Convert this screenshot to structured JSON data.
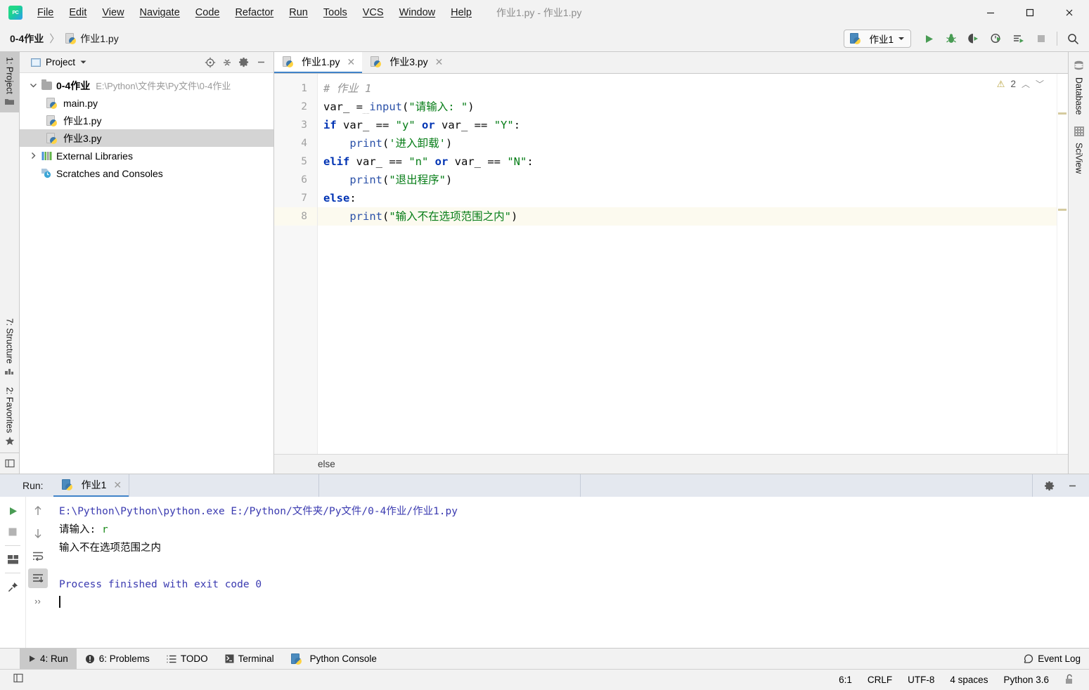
{
  "window": {
    "title": "作业1.py - 作业1.py",
    "logo": "pycharm-logo",
    "controls": {
      "minimize": "minimize-icon",
      "maximize": "maximize-icon",
      "close": "close-icon"
    }
  },
  "menu": [
    {
      "label": "File",
      "mnemonic": "F"
    },
    {
      "label": "Edit",
      "mnemonic": "E"
    },
    {
      "label": "View",
      "mnemonic": "V"
    },
    {
      "label": "Navigate",
      "mnemonic": "N"
    },
    {
      "label": "Code",
      "mnemonic": "C"
    },
    {
      "label": "Refactor",
      "mnemonic": "R"
    },
    {
      "label": "Run",
      "mnemonic": "u"
    },
    {
      "label": "Tools",
      "mnemonic": "T"
    },
    {
      "label": "VCS",
      "mnemonic": "S"
    },
    {
      "label": "Window",
      "mnemonic": "W"
    },
    {
      "label": "Help",
      "mnemonic": "H"
    }
  ],
  "breadcrumb": {
    "project": "0-4作业",
    "separator": "〉",
    "file": "作业1.py"
  },
  "run_toolbar": {
    "config_name": "作业1",
    "buttons": [
      "run-icon",
      "debug-icon",
      "run-coverage-icon",
      "profile-icon",
      "run-with-console-icon",
      "stop-icon",
      "search-everywhere-icon"
    ]
  },
  "left_strip": {
    "top": [
      {
        "label": "1: Project",
        "icon": "project-icon",
        "active": true
      }
    ],
    "bottom": [
      {
        "label": "7: Structure",
        "icon": "structure-icon",
        "active": false
      },
      {
        "label": "2: Favorites",
        "icon": "favorites-star-icon",
        "active": false
      }
    ],
    "bottom_icon": "layout-icon"
  },
  "right_strip": [
    {
      "label": "Database",
      "icon": "database-icon"
    },
    {
      "label": "SciView",
      "icon": "sciview-grid-icon"
    }
  ],
  "project_panel": {
    "title": "Project",
    "dropdown": "chevron-down-icon",
    "header_buttons": [
      "locate-icon",
      "collapse-all-icon",
      "settings-gear-icon",
      "hide-icon"
    ],
    "tree": [
      {
        "label": "0-4作业",
        "path": "E:\\Python\\文件夹\\Py文件\\0-4作业",
        "icon": "folder-icon",
        "twisty": "expanded",
        "depth": 0,
        "bold": true,
        "selected": false
      },
      {
        "label": "main.py",
        "path": "",
        "icon": "python-file-icon",
        "twisty": "none",
        "depth": 1,
        "bold": false,
        "selected": false
      },
      {
        "label": "作业1.py",
        "path": "",
        "icon": "python-file-icon",
        "twisty": "none",
        "depth": 1,
        "bold": false,
        "selected": false
      },
      {
        "label": "作业3.py",
        "path": "",
        "icon": "python-file-icon",
        "twisty": "none",
        "depth": 1,
        "bold": false,
        "selected": true
      },
      {
        "label": "External Libraries",
        "path": "",
        "icon": "libraries-icon",
        "twisty": "collapsed",
        "depth": 0,
        "bold": false,
        "selected": false
      },
      {
        "label": "Scratches and Consoles",
        "path": "",
        "icon": "scratches-icon",
        "twisty": "none",
        "depth": 0,
        "bold": false,
        "selected": false
      }
    ]
  },
  "editor": {
    "tabs": [
      {
        "label": "作业1.py",
        "icon": "python-file-icon",
        "active": true,
        "close": "close-icon"
      },
      {
        "label": "作业3.py",
        "icon": "python-file-icon",
        "active": false,
        "close": "close-icon"
      }
    ],
    "inspection": {
      "warning_icon": "warning-triangle-icon",
      "warning_count": "2",
      "prev": "chevron-up-icon",
      "next": "chevron-down-icon"
    },
    "line_numbers": [
      "1",
      "2",
      "3",
      "4",
      "5",
      "6",
      "7",
      "8"
    ],
    "current_line": 8,
    "lines": [
      {
        "n": 1,
        "tokens": [
          {
            "t": "# 作业 1",
            "c": "comment"
          }
        ]
      },
      {
        "n": 2,
        "tokens": [
          {
            "t": "var_ ",
            "c": "plain"
          },
          {
            "t": "=",
            "c": "op"
          },
          {
            "t": " ",
            "c": "squiggle"
          },
          {
            "t": "input",
            "c": "builtin"
          },
          {
            "t": "(",
            "c": "plain"
          },
          {
            "t": "\"请输入: \"",
            "c": "str"
          },
          {
            "t": ")",
            "c": "plain"
          }
        ]
      },
      {
        "n": 3,
        "tokens": [
          {
            "t": "if",
            "c": "kw"
          },
          {
            "t": " var_ == ",
            "c": "plain"
          },
          {
            "t": "\"y\"",
            "c": "str"
          },
          {
            "t": " ",
            "c": "plain"
          },
          {
            "t": "or",
            "c": "kw"
          },
          {
            "t": " var_ == ",
            "c": "plain"
          },
          {
            "t": "\"Y\"",
            "c": "str"
          },
          {
            "t": ":",
            "c": "plain"
          }
        ]
      },
      {
        "n": 4,
        "tokens": [
          {
            "t": "    ",
            "c": "plain"
          },
          {
            "t": "print",
            "c": "builtin"
          },
          {
            "t": "(",
            "c": "plain"
          },
          {
            "t": "'进入卸载'",
            "c": "str"
          },
          {
            "t": ")",
            "c": "plain"
          }
        ]
      },
      {
        "n": 5,
        "tokens": [
          {
            "t": "elif",
            "c": "kw"
          },
          {
            "t": " var_ == ",
            "c": "plain"
          },
          {
            "t": "\"n\"",
            "c": "str"
          },
          {
            "t": " ",
            "c": "plain"
          },
          {
            "t": "or",
            "c": "kw"
          },
          {
            "t": " var_ == ",
            "c": "plain"
          },
          {
            "t": "\"N\"",
            "c": "str"
          },
          {
            "t": ":",
            "c": "plain"
          }
        ]
      },
      {
        "n": 6,
        "tokens": [
          {
            "t": "    ",
            "c": "plain"
          },
          {
            "t": "print",
            "c": "builtin"
          },
          {
            "t": "(",
            "c": "plain"
          },
          {
            "t": "\"退出程序\"",
            "c": "str"
          },
          {
            "t": ")",
            "c": "plain"
          }
        ]
      },
      {
        "n": 7,
        "tokens": [
          {
            "t": "else",
            "c": "kw"
          },
          {
            "t": ":",
            "c": "plain"
          }
        ]
      },
      {
        "n": 8,
        "tokens": [
          {
            "t": "    ",
            "c": "plain"
          },
          {
            "t": "print",
            "c": "builtin"
          },
          {
            "t": "(",
            "c": "plain"
          },
          {
            "t": "\"输入不在选项范围之内\"",
            "c": "str"
          },
          {
            "t": ")",
            "c": "plain"
          }
        ]
      }
    ],
    "breadcrumb_trail": "else"
  },
  "run_window": {
    "label": "Run:",
    "tab": {
      "label": "作业1",
      "icon": "python-icon",
      "close": "close-icon"
    },
    "header_buttons": [
      "settings-gear-icon",
      "hide-window-icon"
    ],
    "side_buttons": [
      "rerun-icon",
      "stop-icon",
      "layout-icon",
      "pin-icon"
    ],
    "side_buttons2": [
      "up-arrow-icon",
      "down-arrow-icon",
      "soft-wrap-icon",
      "scroll-to-end-icon",
      "more-icon"
    ],
    "console": [
      {
        "text": "E:\\Python\\Python\\python.exe E:/Python/文件夹/Py文件/0-4作业/作业1.py",
        "style": "cmd"
      },
      {
        "text": "请输入: ",
        "style": "plain",
        "suffix": "r",
        "suffix_style": "green"
      },
      {
        "text": "输入不在选项范围之内",
        "style": "plain"
      },
      {
        "text": "",
        "style": "plain"
      },
      {
        "text": "Process finished with exit code 0",
        "style": "cmd"
      }
    ]
  },
  "bottom_bar": {
    "items": [
      {
        "label": "4: Run",
        "mnemonic": "4",
        "icon": "run-triangle-icon",
        "active": true
      },
      {
        "label": "6: Problems",
        "mnemonic": "6",
        "icon": "problems-icon",
        "active": false
      },
      {
        "label": "TODO",
        "mnemonic": "",
        "icon": "todo-list-icon",
        "active": false
      },
      {
        "label": "Terminal",
        "mnemonic": "",
        "icon": "terminal-icon",
        "active": false
      },
      {
        "label": "Python Console",
        "mnemonic": "",
        "icon": "python-icon",
        "active": false
      }
    ],
    "event_log": {
      "label": "Event Log",
      "icon": "event-log-icon"
    }
  },
  "status_bar": {
    "cells": [
      "6:1",
      "CRLF",
      "UTF-8",
      "4 spaces",
      "Python 3.6"
    ],
    "lock_icon": "unlocked-padlock-icon",
    "left_icon": "window-toggle-icon"
  },
  "colors": {
    "accent_blue": "#4083c9",
    "keyword": "#0033b3",
    "string": "#067d17",
    "comment": "#969696",
    "builtin": "#2b51a8",
    "console_cmd": "#3a3ab0",
    "selection": "#d4d4d4",
    "current_line": "#fcfaef",
    "run_header": "#e4e8ef",
    "chrome": "#f2f2f2"
  }
}
